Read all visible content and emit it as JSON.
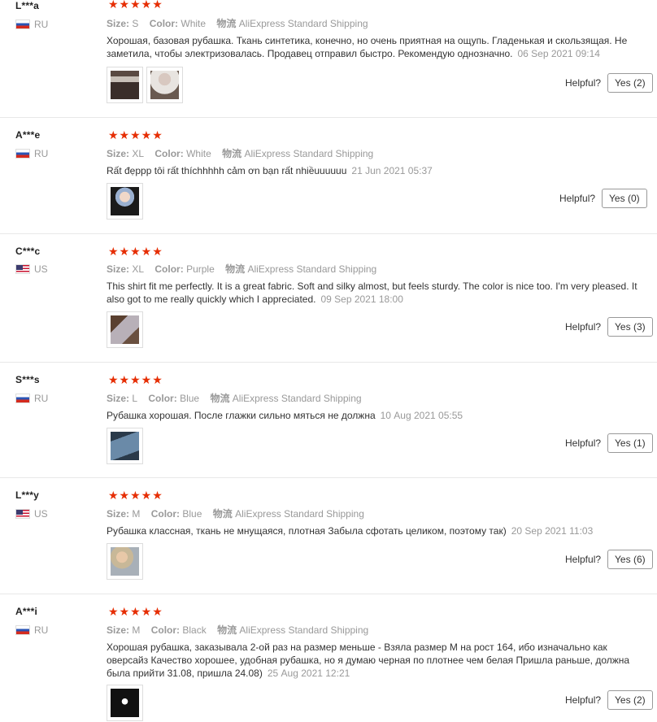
{
  "reviews": [
    {
      "user": "L***a",
      "country": "RU",
      "stars": "★★★★★",
      "size_label": "Size:",
      "size": "S",
      "color_label": "Color:",
      "color": "White",
      "ship_label": "物流",
      "ship": "AliExpress Standard Shipping",
      "text": "Хорошая, базовая рубашка. Ткань синтетика, конечно, но очень приятная на ощупь. Гладенькая и скользящая. Не заметила, чтобы электризовалась. Продавец отправил быстро. Рекомендую однозначно.",
      "date": "06 Sep 2021 09:14",
      "helpful": "Helpful?",
      "yes": "Yes (2)"
    },
    {
      "user": "A***e",
      "country": "RU",
      "stars": "★★★★★",
      "size_label": "Size:",
      "size": "XL",
      "color_label": "Color:",
      "color": "White",
      "ship_label": "物流",
      "ship": "AliExpress Standard Shipping",
      "text": "Rất đẹppp tôi rất thíchhhhh cảm ơn bạn rất nhiềuuuuuu",
      "date": "21 Jun 2021 05:37",
      "helpful": "Helpful?",
      "yes": "Yes (0)"
    },
    {
      "user": "C***c",
      "country": "US",
      "stars": "★★★★★",
      "size_label": "Size:",
      "size": "XL",
      "color_label": "Color:",
      "color": "Purple",
      "ship_label": "物流",
      "ship": "AliExpress Standard Shipping",
      "text": "This shirt fit me perfectly. It is a great fabric. Soft and silky almost, but feels sturdy. The color is nice too. I'm very pleased. It also got to me really quickly which I appreciated.",
      "date": "09 Sep 2021 18:00",
      "helpful": "Helpful?",
      "yes": "Yes (3)"
    },
    {
      "user": "S***s",
      "country": "RU",
      "stars": "★★★★★",
      "size_label": "Size:",
      "size": "L",
      "color_label": "Color:",
      "color": "Blue",
      "ship_label": "物流",
      "ship": "AliExpress Standard Shipping",
      "text": "Рубашка хорошая. После глажки сильно мяться не должна",
      "date": "10 Aug 2021 05:55",
      "helpful": "Helpful?",
      "yes": "Yes (1)"
    },
    {
      "user": "L***y",
      "country": "US",
      "stars": "★★★★★",
      "size_label": "Size:",
      "size": "M",
      "color_label": "Color:",
      "color": "Blue",
      "ship_label": "物流",
      "ship": "AliExpress Standard Shipping",
      "text": "Рубашка классная, ткань не мнущаяся, плотная Забыла сфотать целиком, поэтому так)",
      "date": "20 Sep 2021 11:03",
      "helpful": "Helpful?",
      "yes": "Yes (6)"
    },
    {
      "user": "A***i",
      "country": "RU",
      "stars": "★★★★★",
      "size_label": "Size:",
      "size": "M",
      "color_label": "Color:",
      "color": "Black",
      "ship_label": "物流",
      "ship": "AliExpress Standard Shipping",
      "text": "Хорошая рубашка, заказывала 2-ой раз на размер меньше - Взяла размер М на рост 164, ибо изначально как оверсайз Качество хорошее, удобная рубашка, но я думаю черная по плотнее чем белая Пришла раньше, должна была прийти 31.08, пришла 24.08)",
      "date": "25 Aug 2021 12:21",
      "helpful": "Helpful?",
      "yes": "Yes (2)"
    }
  ]
}
